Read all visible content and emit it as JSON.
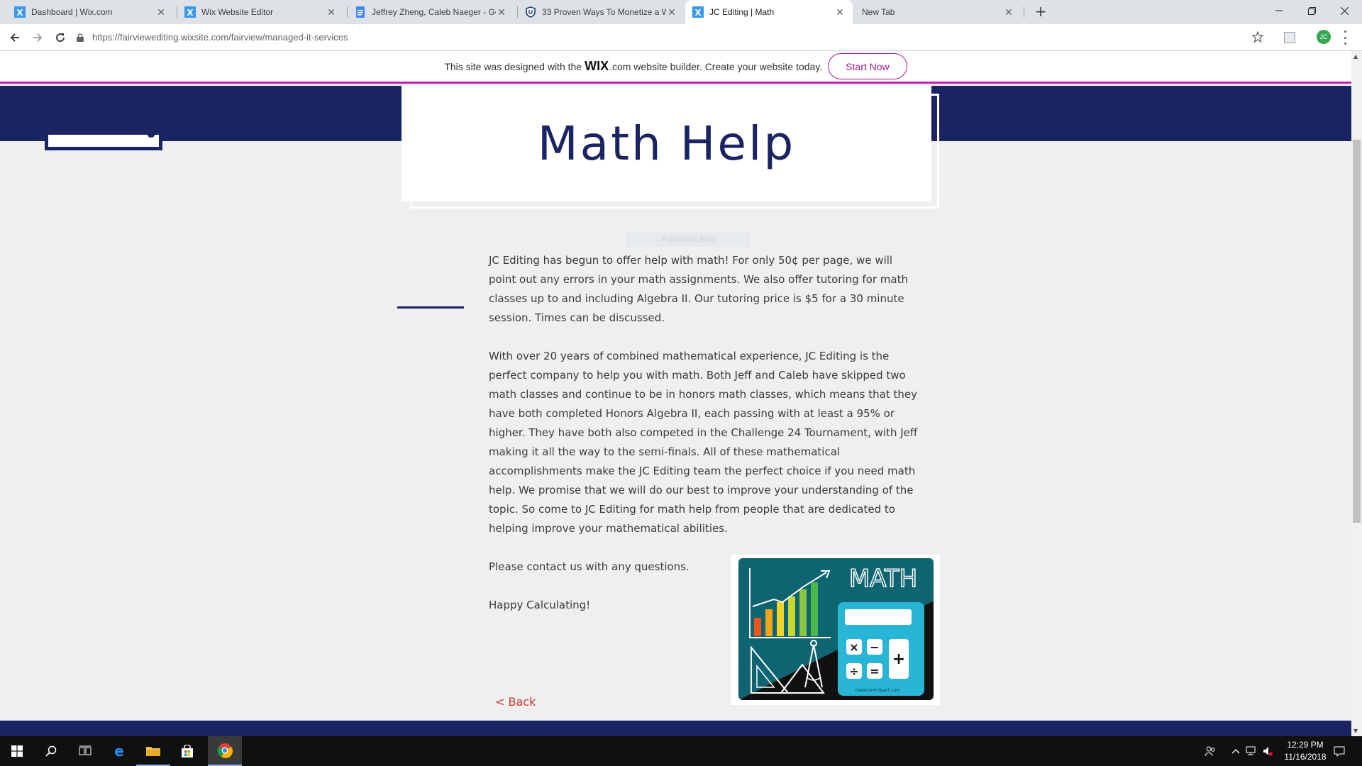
{
  "browser": {
    "tabs": [
      {
        "title": "Dashboard | Wix.com",
        "icon": "wix-icon",
        "active": false
      },
      {
        "title": "Wix Website Editor",
        "icon": "wix-icon",
        "active": false
      },
      {
        "title": "Jeffrey Zheng, Caleb Naeger - Go",
        "icon": "google-docs-icon",
        "active": false
      },
      {
        "title": "33 Proven Ways To Monetize a W",
        "icon": "shield-icon",
        "active": false
      },
      {
        "title": "JC Editing | Math",
        "icon": "wix-icon",
        "active": true
      },
      {
        "title": "New Tab",
        "icon": "",
        "active": false
      }
    ],
    "url": "https://fairviewediting.wixsite.com/fairview/managed-it-services",
    "profile_initials": "JC"
  },
  "wix_banner": {
    "text_before": "This site was designed with the",
    "logo": "WIX",
    "text_after": ".com website builder. Create your website today.",
    "cta": "Start Now"
  },
  "page": {
    "title": "Math Help",
    "ghost_text": "Fullscreen Snip",
    "paragraphs": [
      "JC Editing has begun to offer help with math! For only 50¢ per page, we will point out any errors in your math assignments. We also offer tutoring for math classes up to and including Algebra II. Our tutoring price is $5 for a 30 minute session. Times can be discussed.",
      "With over 20 years of combined mathematical experience, JC Editing is the perfect company to help you with math. Both Jeff and Caleb have skipped two math classes and continue to be in honors math classes, which means that they have both completed Honors Algebra II, each passing with at least a 95% or higher. They have both also competed in the Challenge 24 Tournament, with Jeff making it all the way to the semi-finals. All of these mathematical accomplishments make the JC Editing team the perfect choice if you need math help. We promise that we will do our best to improve your understanding of the topic. So come to JC Editing for math help from people that are dedicated to helping improve your mathematical abilities.",
      "Please contact us with any questions.",
      "Happy Calculating!"
    ],
    "math_image": {
      "word": "MATH",
      "keys": [
        "×",
        "−",
        "÷",
        "=",
        "+"
      ],
      "credit": "classroomclipart.com"
    },
    "back_link": "< Back"
  },
  "taskbar": {
    "clock_time": "12:29 PM",
    "clock_date": "11/16/2018"
  },
  "colors": {
    "navy": "#1a2463",
    "wix_magenta": "#c81bb9",
    "back_link": "#c0392b"
  }
}
